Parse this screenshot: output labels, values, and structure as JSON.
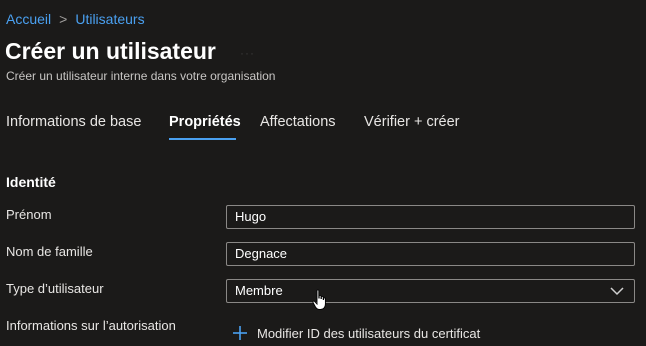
{
  "breadcrumb": {
    "items": [
      "Accueil",
      "Utilisateurs"
    ],
    "separator": ">"
  },
  "header": {
    "title": "Créer un utilisateur",
    "ellipsis": "···",
    "subtitle": "Créer un utilisateur interne dans votre organisation"
  },
  "tabs": [
    {
      "label": "Informations de base",
      "active": false
    },
    {
      "label": "Propriétés",
      "active": true
    },
    {
      "label": "Affectations",
      "active": false
    },
    {
      "label": "Vérifier + créer",
      "active": false
    }
  ],
  "identity": {
    "section_title": "Identité",
    "first_name_label": "Prénom",
    "first_name_value": "Hugo",
    "last_name_label": "Nom de famille",
    "last_name_value": "Degnace",
    "user_type_label": "Type d’utilisateur",
    "user_type_value": "Membre",
    "authorization_label": "Informations sur l’autorisation",
    "authorization_link": "Modifier ID des utilisateurs du certificat"
  },
  "colors": {
    "background": "#1b1a19",
    "accent": "#4aa0f0",
    "border": "#8a8886"
  },
  "icons": {
    "breadcrumb_separator": "chevron-right-icon",
    "select_chevron": "chevron-down-icon",
    "add": "plus-icon",
    "pointer": "hand-cursor-icon"
  }
}
